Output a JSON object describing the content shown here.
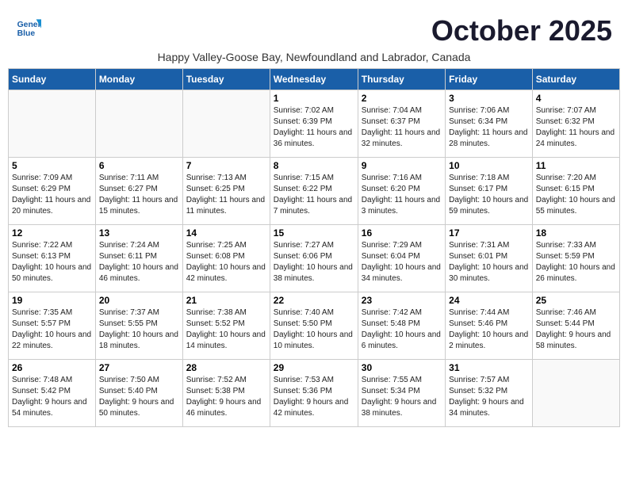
{
  "header": {
    "logo_line1": "General",
    "logo_line2": "Blue",
    "month": "October 2025",
    "subtitle": "Happy Valley-Goose Bay, Newfoundland and Labrador, Canada"
  },
  "weekdays": [
    "Sunday",
    "Monday",
    "Tuesday",
    "Wednesday",
    "Thursday",
    "Friday",
    "Saturday"
  ],
  "weeks": [
    [
      {
        "day": "",
        "content": ""
      },
      {
        "day": "",
        "content": ""
      },
      {
        "day": "",
        "content": ""
      },
      {
        "day": "1",
        "content": "Sunrise: 7:02 AM\nSunset: 6:39 PM\nDaylight: 11 hours and 36 minutes."
      },
      {
        "day": "2",
        "content": "Sunrise: 7:04 AM\nSunset: 6:37 PM\nDaylight: 11 hours and 32 minutes."
      },
      {
        "day": "3",
        "content": "Sunrise: 7:06 AM\nSunset: 6:34 PM\nDaylight: 11 hours and 28 minutes."
      },
      {
        "day": "4",
        "content": "Sunrise: 7:07 AM\nSunset: 6:32 PM\nDaylight: 11 hours and 24 minutes."
      }
    ],
    [
      {
        "day": "5",
        "content": "Sunrise: 7:09 AM\nSunset: 6:29 PM\nDaylight: 11 hours and 20 minutes."
      },
      {
        "day": "6",
        "content": "Sunrise: 7:11 AM\nSunset: 6:27 PM\nDaylight: 11 hours and 15 minutes."
      },
      {
        "day": "7",
        "content": "Sunrise: 7:13 AM\nSunset: 6:25 PM\nDaylight: 11 hours and 11 minutes."
      },
      {
        "day": "8",
        "content": "Sunrise: 7:15 AM\nSunset: 6:22 PM\nDaylight: 11 hours and 7 minutes."
      },
      {
        "day": "9",
        "content": "Sunrise: 7:16 AM\nSunset: 6:20 PM\nDaylight: 11 hours and 3 minutes."
      },
      {
        "day": "10",
        "content": "Sunrise: 7:18 AM\nSunset: 6:17 PM\nDaylight: 10 hours and 59 minutes."
      },
      {
        "day": "11",
        "content": "Sunrise: 7:20 AM\nSunset: 6:15 PM\nDaylight: 10 hours and 55 minutes."
      }
    ],
    [
      {
        "day": "12",
        "content": "Sunrise: 7:22 AM\nSunset: 6:13 PM\nDaylight: 10 hours and 50 minutes."
      },
      {
        "day": "13",
        "content": "Sunrise: 7:24 AM\nSunset: 6:11 PM\nDaylight: 10 hours and 46 minutes."
      },
      {
        "day": "14",
        "content": "Sunrise: 7:25 AM\nSunset: 6:08 PM\nDaylight: 10 hours and 42 minutes."
      },
      {
        "day": "15",
        "content": "Sunrise: 7:27 AM\nSunset: 6:06 PM\nDaylight: 10 hours and 38 minutes."
      },
      {
        "day": "16",
        "content": "Sunrise: 7:29 AM\nSunset: 6:04 PM\nDaylight: 10 hours and 34 minutes."
      },
      {
        "day": "17",
        "content": "Sunrise: 7:31 AM\nSunset: 6:01 PM\nDaylight: 10 hours and 30 minutes."
      },
      {
        "day": "18",
        "content": "Sunrise: 7:33 AM\nSunset: 5:59 PM\nDaylight: 10 hours and 26 minutes."
      }
    ],
    [
      {
        "day": "19",
        "content": "Sunrise: 7:35 AM\nSunset: 5:57 PM\nDaylight: 10 hours and 22 minutes."
      },
      {
        "day": "20",
        "content": "Sunrise: 7:37 AM\nSunset: 5:55 PM\nDaylight: 10 hours and 18 minutes."
      },
      {
        "day": "21",
        "content": "Sunrise: 7:38 AM\nSunset: 5:52 PM\nDaylight: 10 hours and 14 minutes."
      },
      {
        "day": "22",
        "content": "Sunrise: 7:40 AM\nSunset: 5:50 PM\nDaylight: 10 hours and 10 minutes."
      },
      {
        "day": "23",
        "content": "Sunrise: 7:42 AM\nSunset: 5:48 PM\nDaylight: 10 hours and 6 minutes."
      },
      {
        "day": "24",
        "content": "Sunrise: 7:44 AM\nSunset: 5:46 PM\nDaylight: 10 hours and 2 minutes."
      },
      {
        "day": "25",
        "content": "Sunrise: 7:46 AM\nSunset: 5:44 PM\nDaylight: 9 hours and 58 minutes."
      }
    ],
    [
      {
        "day": "26",
        "content": "Sunrise: 7:48 AM\nSunset: 5:42 PM\nDaylight: 9 hours and 54 minutes."
      },
      {
        "day": "27",
        "content": "Sunrise: 7:50 AM\nSunset: 5:40 PM\nDaylight: 9 hours and 50 minutes."
      },
      {
        "day": "28",
        "content": "Sunrise: 7:52 AM\nSunset: 5:38 PM\nDaylight: 9 hours and 46 minutes."
      },
      {
        "day": "29",
        "content": "Sunrise: 7:53 AM\nSunset: 5:36 PM\nDaylight: 9 hours and 42 minutes."
      },
      {
        "day": "30",
        "content": "Sunrise: 7:55 AM\nSunset: 5:34 PM\nDaylight: 9 hours and 38 minutes."
      },
      {
        "day": "31",
        "content": "Sunrise: 7:57 AM\nSunset: 5:32 PM\nDaylight: 9 hours and 34 minutes."
      },
      {
        "day": "",
        "content": ""
      }
    ]
  ]
}
